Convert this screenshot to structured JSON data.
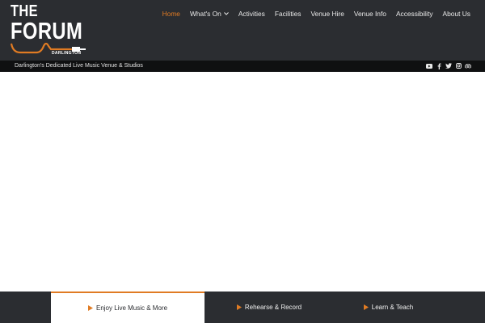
{
  "brand": {
    "logo_line1": "THE",
    "logo_line2": "FORUM",
    "logo_town": "DARLINGTON",
    "tagline": "Darlington's Dedicated Live Music Venue & Studios"
  },
  "nav": {
    "items": [
      {
        "label": "Home",
        "active": true
      },
      {
        "label": "What's On",
        "dropdown": true
      },
      {
        "label": "Activities"
      },
      {
        "label": "Facilities"
      },
      {
        "label": "Venue Hire"
      },
      {
        "label": "Venue Info"
      },
      {
        "label": "Accessibility"
      },
      {
        "label": "About Us"
      }
    ]
  },
  "socials": [
    "youtube-icon",
    "facebook-icon",
    "twitter-icon",
    "instagram-icon",
    "tripadvisor-icon"
  ],
  "footer_tabs": [
    {
      "label": "Enjoy Live Music & More",
      "active": true
    },
    {
      "label": "Rehearse & Record"
    },
    {
      "label": "Learn & Teach"
    }
  ],
  "colors": {
    "accent": "#e07b23",
    "header_bg": "#2b2d31",
    "tagline_bg": "#0f1011"
  }
}
